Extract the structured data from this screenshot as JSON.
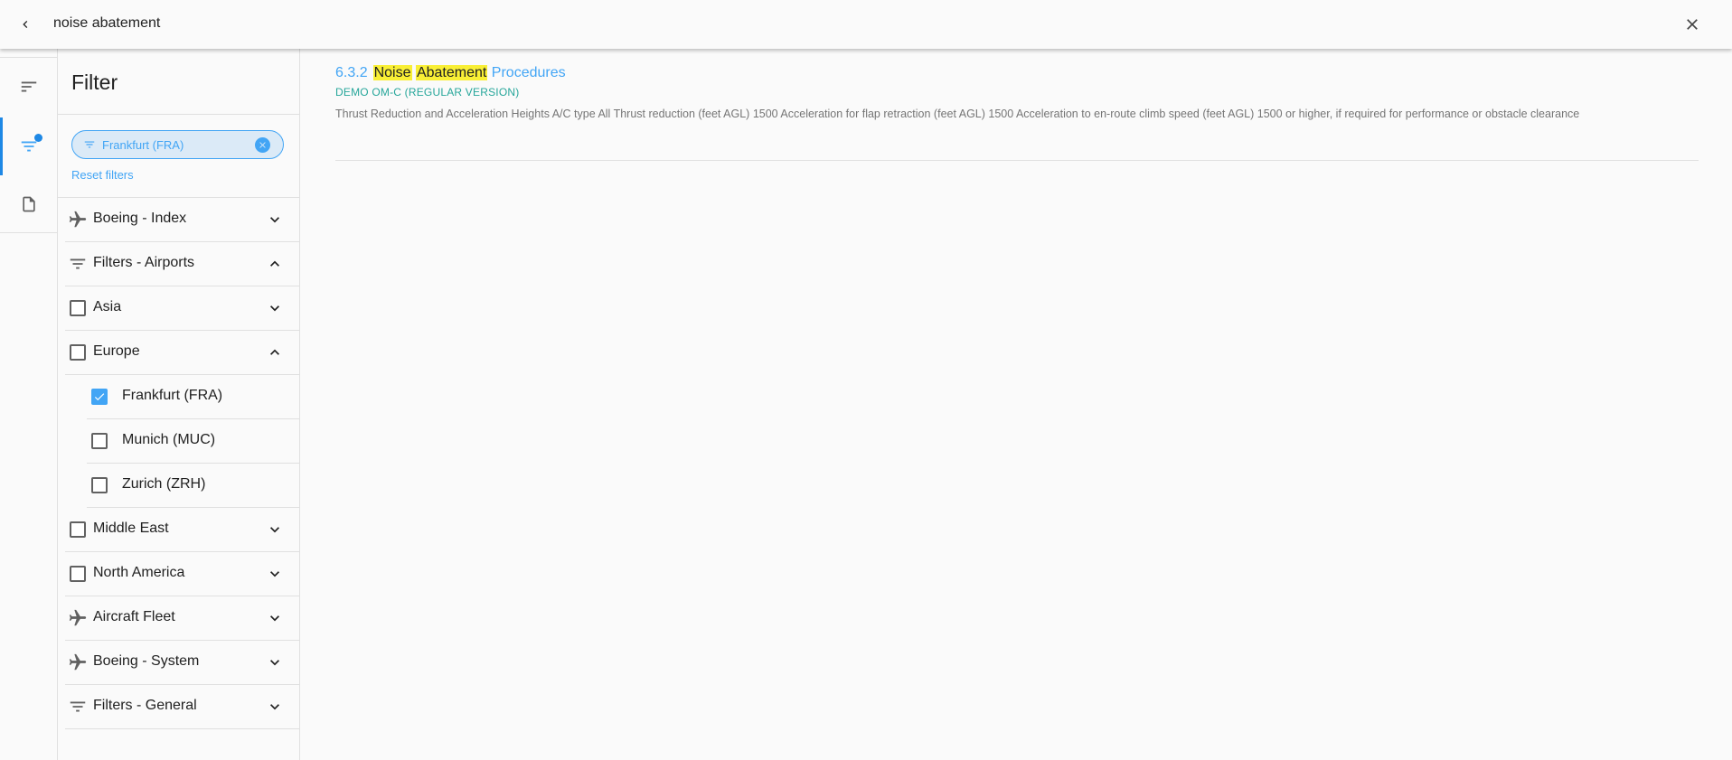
{
  "search": {
    "query": "noise abatement"
  },
  "filter_panel": {
    "title": "Filter",
    "active_chip": "Frankfurt (FRA)",
    "reset_label": "Reset filters",
    "items": [
      {
        "label": "Boeing - Index",
        "icon": "airplane-icon",
        "expanded": false
      },
      {
        "label": "Filters - Airports",
        "icon": "filter-icon",
        "expanded": true
      },
      {
        "label": "Asia",
        "icon": "checkbox",
        "checked": false,
        "expanded": false
      },
      {
        "label": "Europe",
        "icon": "checkbox",
        "checked": false,
        "expanded": true
      },
      {
        "label": "Frankfurt (FRA)",
        "icon": "checkbox",
        "checked": true
      },
      {
        "label": "Munich (MUC)",
        "icon": "checkbox",
        "checked": false
      },
      {
        "label": "Zurich (ZRH)",
        "icon": "checkbox",
        "checked": false
      },
      {
        "label": "Middle East",
        "icon": "checkbox",
        "checked": false,
        "expanded": false
      },
      {
        "label": "North America",
        "icon": "checkbox",
        "checked": false,
        "expanded": false
      },
      {
        "label": "Aircraft Fleet",
        "icon": "airplane-icon",
        "expanded": false
      },
      {
        "label": "Boeing - System",
        "icon": "airplane-icon",
        "expanded": false
      },
      {
        "label": "Filters - General",
        "icon": "filter-icon",
        "expanded": false
      }
    ]
  },
  "result": {
    "number": "6.3.2",
    "title_hl1": "Noise",
    "title_hl2": "Abatement",
    "title_rest": "Procedures",
    "source": "DEMO OM-C (REGULAR VERSION)",
    "snippet": "Thrust Reduction and Acceleration Heights A/C type All Thrust reduction (feet AGL) 1500 Acceleration for flap retraction (feet AGL) 1500 Acceleration to en-route climb speed (feet AGL) 1500 or higher, if required for performance or obstacle clearance"
  },
  "colors": {
    "accent": "#42a5f5",
    "highlight": "#f9ef35",
    "source": "#26a69a"
  }
}
